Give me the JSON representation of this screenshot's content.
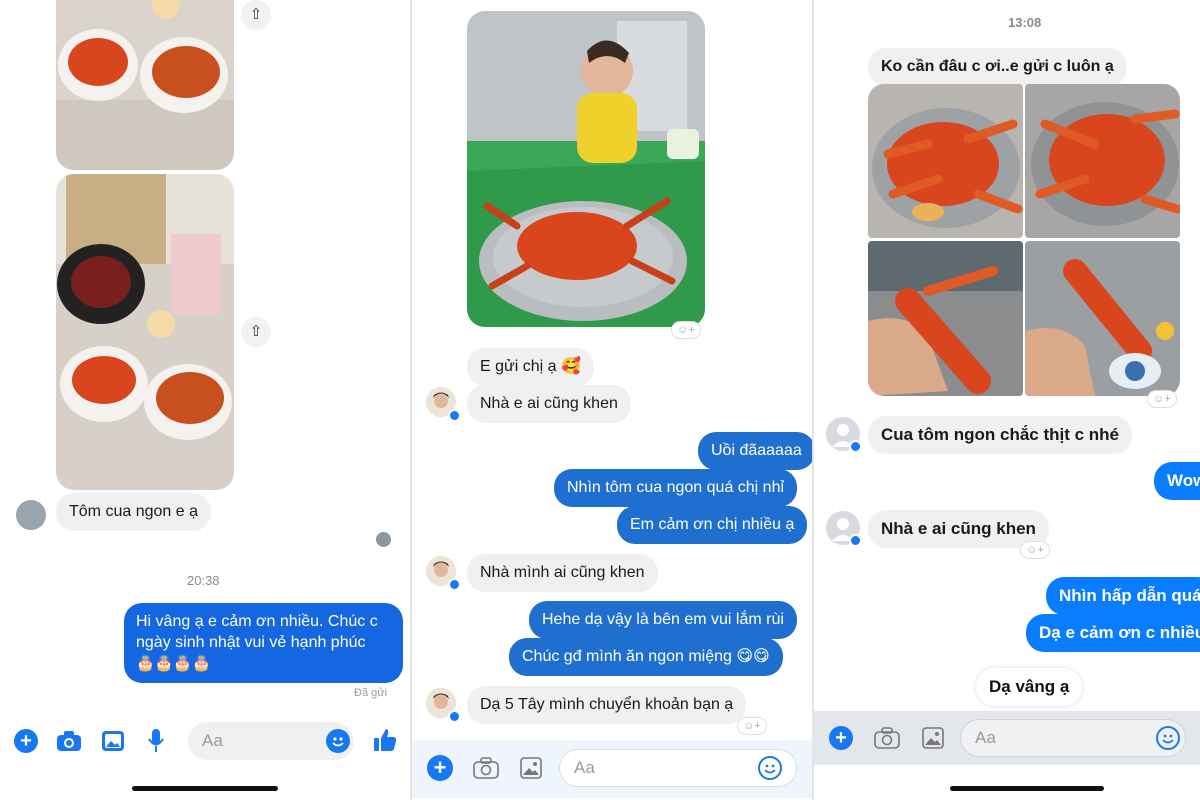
{
  "panel1": {
    "msg_tom_cua": "Tôm cua ngon e ạ",
    "time": "20:38",
    "out_line1": "Hi vâng ạ e cảm ơn nhiều. Chúc c",
    "out_line2": "ngày sinh nhật vui vẻ hạnh phúc",
    "out_emoji": "🎂🎂🎂🎂",
    "status": "Đã gửi",
    "input_placeholder": "Aa"
  },
  "panel2": {
    "msg1": "E gửi chị ạ 🥰",
    "msg2": "Nhà e ai cũng khen",
    "out1": "Uồi đãaaaaa",
    "out2": "Nhìn tôm cua ngon quá chị nhỉ",
    "out3": "Em cảm ơn chị nhiều ạ",
    "msg3": "Nhà mình ai cũng khen",
    "out4": "Hehe dạ vậy là bên em vui lắm rùi",
    "out5": "Chúc gđ mình ăn ngon miệng 😋😋",
    "msg4": "Dạ 5 Tây mình chuyển khoản bạn ạ",
    "input_placeholder": "Aa"
  },
  "panel3": {
    "time": "13:08",
    "msg_top": "Ko cần đâu c ơi..e gửi c luôn ạ",
    "msg1": "Cua tôm ngon chắc thịt c nhé",
    "out1": "Wow",
    "msg2": "Nhà e ai cũng khen",
    "out2": "Nhìn hấp dẫn quá",
    "out3": "Dạ e cảm ơn c nhiều",
    "msg3": "Dạ vâng ạ",
    "input_placeholder": "Aa"
  },
  "colors": {
    "accent": "#0a7cff",
    "icon_blue": "#1877f2",
    "incoming": "#f0f0f0",
    "lobster": "#d9461e",
    "tablecloth": "#2f9a49"
  },
  "icons": [
    "plus-icon",
    "camera-icon",
    "image-icon",
    "mic-icon",
    "emoji-icon",
    "like-icon",
    "share-icon",
    "smile-react-icon",
    "messenger-badge-icon"
  ]
}
